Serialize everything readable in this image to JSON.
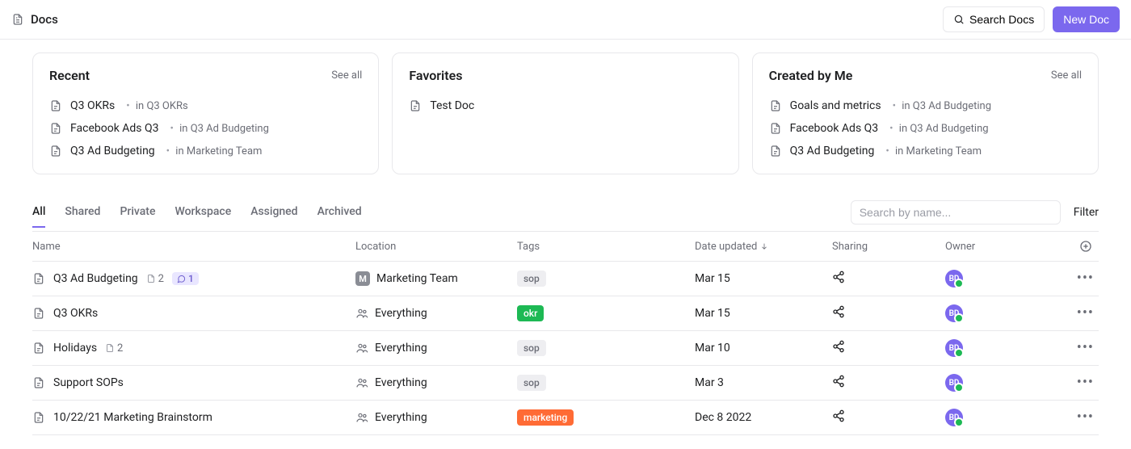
{
  "header": {
    "title": "Docs",
    "search_label": "Search Docs",
    "new_doc_label": "New Doc"
  },
  "cards": {
    "recent": {
      "title": "Recent",
      "see_all": "See all",
      "items": [
        {
          "name": "Q3 OKRs",
          "location": "Q3 OKRs"
        },
        {
          "name": "Facebook Ads Q3",
          "location": "Q3 Ad Budgeting"
        },
        {
          "name": "Q3 Ad Budgeting",
          "location": "Marketing Team"
        }
      ]
    },
    "favorites": {
      "title": "Favorites",
      "items": [
        {
          "name": "Test Doc"
        }
      ]
    },
    "created": {
      "title": "Created by Me",
      "see_all": "See all",
      "items": [
        {
          "name": "Goals and metrics",
          "location": "Q3 Ad Budgeting"
        },
        {
          "name": "Facebook Ads Q3",
          "location": "Q3 Ad Budgeting"
        },
        {
          "name": "Q3 Ad Budgeting",
          "location": "Marketing Team"
        }
      ]
    }
  },
  "tabs": {
    "items": [
      "All",
      "Shared",
      "Private",
      "Workspace",
      "Assigned",
      "Archived"
    ],
    "active_index": 0,
    "search_placeholder": "Search by name...",
    "filter_label": "Filter"
  },
  "table": {
    "columns": {
      "name": "Name",
      "location": "Location",
      "tags": "Tags",
      "date_updated": "Date updated",
      "sharing": "Sharing",
      "owner": "Owner"
    },
    "sort_col": "date_updated",
    "sort_dir": "desc",
    "rows": [
      {
        "name": "Q3 Ad Budgeting",
        "subdocs": "2",
        "comments": "1",
        "location_type": "space",
        "location_abbr": "M",
        "location": "Marketing Team",
        "tag": {
          "label": "sop",
          "color": "grey"
        },
        "date": "Mar 15",
        "owner": "BD"
      },
      {
        "name": "Q3 OKRs",
        "location_type": "everything",
        "location": "Everything",
        "tag": {
          "label": "okr",
          "color": "green"
        },
        "date": "Mar 15",
        "owner": "BD"
      },
      {
        "name": "Holidays",
        "subdocs": "2",
        "location_type": "everything",
        "location": "Everything",
        "tag": {
          "label": "sop",
          "color": "grey"
        },
        "date": "Mar 10",
        "owner": "BD"
      },
      {
        "name": "Support SOPs",
        "location_type": "everything",
        "location": "Everything",
        "tag": {
          "label": "sop",
          "color": "grey"
        },
        "date": "Mar 3",
        "owner": "BD"
      },
      {
        "name": "10/22/21 Marketing Brainstorm",
        "location_type": "everything",
        "location": "Everything",
        "tag": {
          "label": "marketing",
          "color": "orange"
        },
        "date": "Dec 8 2022",
        "owner": "BD"
      }
    ]
  },
  "location_prefix": "in "
}
